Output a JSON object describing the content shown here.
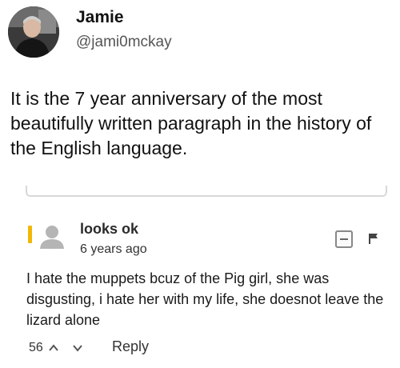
{
  "author": {
    "name": "Jamie",
    "handle": "@jami0mckay"
  },
  "tweet": {
    "text": "It is the 7 year anniversary of the most beautifully written paragraph in the history of the English language."
  },
  "comment": {
    "username": "looks ok",
    "time": "6 years ago",
    "body": "I hate the muppets bcuz of the Pig girl, she was disgusting, i hate her with my life, she doesnot leave the lizard alone",
    "vote_count": "56",
    "reply_label": "Reply",
    "accent_color": "#f2b705"
  },
  "icons": {
    "avatar": "profile-photo",
    "comment_avatar": "default-user-icon",
    "collapse": "minus-box-icon",
    "flag": "flag-icon",
    "upvote": "chevron-up-icon",
    "downvote": "chevron-down-icon"
  }
}
